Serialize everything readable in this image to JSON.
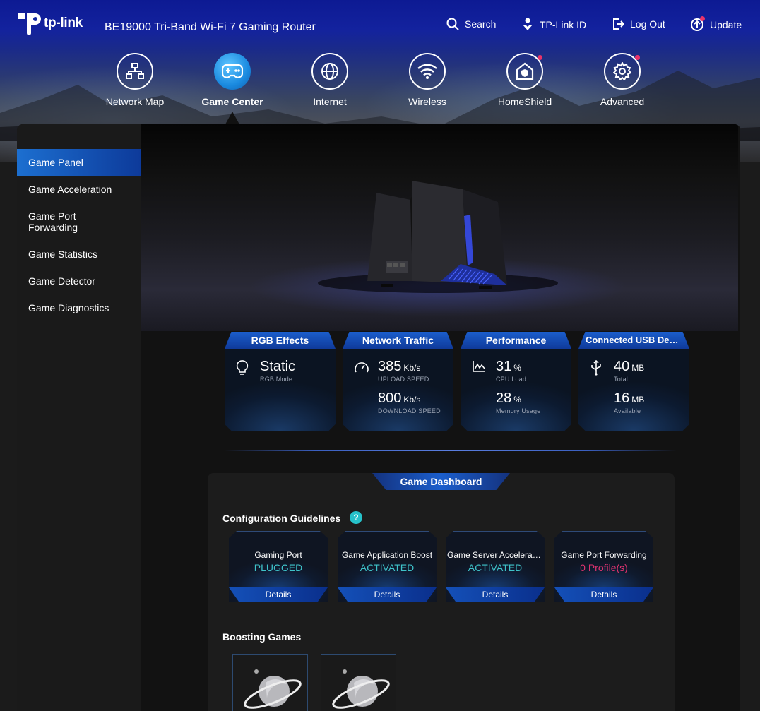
{
  "brand": {
    "logo_text": "tp-link",
    "model": "BE19000 Tri-Band Wi-Fi 7 Gaming Router"
  },
  "toolbar": [
    {
      "label": "Search",
      "icon": "search-icon"
    },
    {
      "label": "TP-Link ID",
      "icon": "tplink-id-icon"
    },
    {
      "label": "Log Out",
      "icon": "logout-icon"
    },
    {
      "label": "Update",
      "icon": "update-icon"
    }
  ],
  "nav": [
    {
      "label": "Network Map",
      "icon": "network-map-icon"
    },
    {
      "label": "Game Center",
      "icon": "gamepad-icon",
      "active": true
    },
    {
      "label": "Internet",
      "icon": "globe-icon"
    },
    {
      "label": "Wireless",
      "icon": "wifi-icon"
    },
    {
      "label": "HomeShield",
      "icon": "homeshield-icon"
    },
    {
      "label": "Advanced",
      "icon": "gear-icon"
    }
  ],
  "sidebar": [
    {
      "label": "Game Panel",
      "active": true
    },
    {
      "label": "Game Acceleration"
    },
    {
      "label": "Game Port Forwarding"
    },
    {
      "label": "Game Statistics"
    },
    {
      "label": "Game Detector"
    },
    {
      "label": "Game Diagnostics"
    }
  ],
  "stats": {
    "rgb": {
      "title": "RGB Effects",
      "value": "Static",
      "caption": "RGB Mode"
    },
    "traffic": {
      "title": "Network Traffic",
      "upload": "385",
      "upload_unit": "Kb/s",
      "upload_caption": "UPLOAD SPEED",
      "download": "800",
      "download_unit": "Kb/s",
      "download_caption": "DOWNLOAD SPEED"
    },
    "performance": {
      "title": "Performance",
      "cpu": "31",
      "cpu_unit": "%",
      "cpu_caption": "CPU Load",
      "mem": "28",
      "mem_unit": "%",
      "mem_caption": "Memory Usage"
    },
    "usb": {
      "title": "Connected USB Devi…",
      "total": "40",
      "total_unit": "MB",
      "total_caption": "Total",
      "avail": "16",
      "avail_unit": "MB",
      "avail_caption": "Available"
    }
  },
  "dashboard": {
    "title": "Game Dashboard",
    "config_heading": "Configuration Guidelines",
    "help_glyph": "?",
    "cards": [
      {
        "name": "Gaming Port",
        "state": "PLUGGED",
        "state_color": "#3fc3c9",
        "button": "Details"
      },
      {
        "name": "Game Application Boost",
        "state": "ACTIVATED",
        "state_color": "#3fc3c9",
        "button": "Details"
      },
      {
        "name": "Game Server Accelerati…",
        "state": "ACTIVATED",
        "state_color": "#3fc3c9",
        "button": "Details"
      },
      {
        "name": "Game Port Forwarding",
        "state": "0 Profile(s)",
        "state_color": "#e0336e",
        "button": "Details"
      }
    ],
    "boosting_heading": "Boosting Games"
  },
  "colors": {
    "accent": "#1b5ecc",
    "notify_dot": "#e8336a",
    "teal": "#3fc3c9"
  }
}
